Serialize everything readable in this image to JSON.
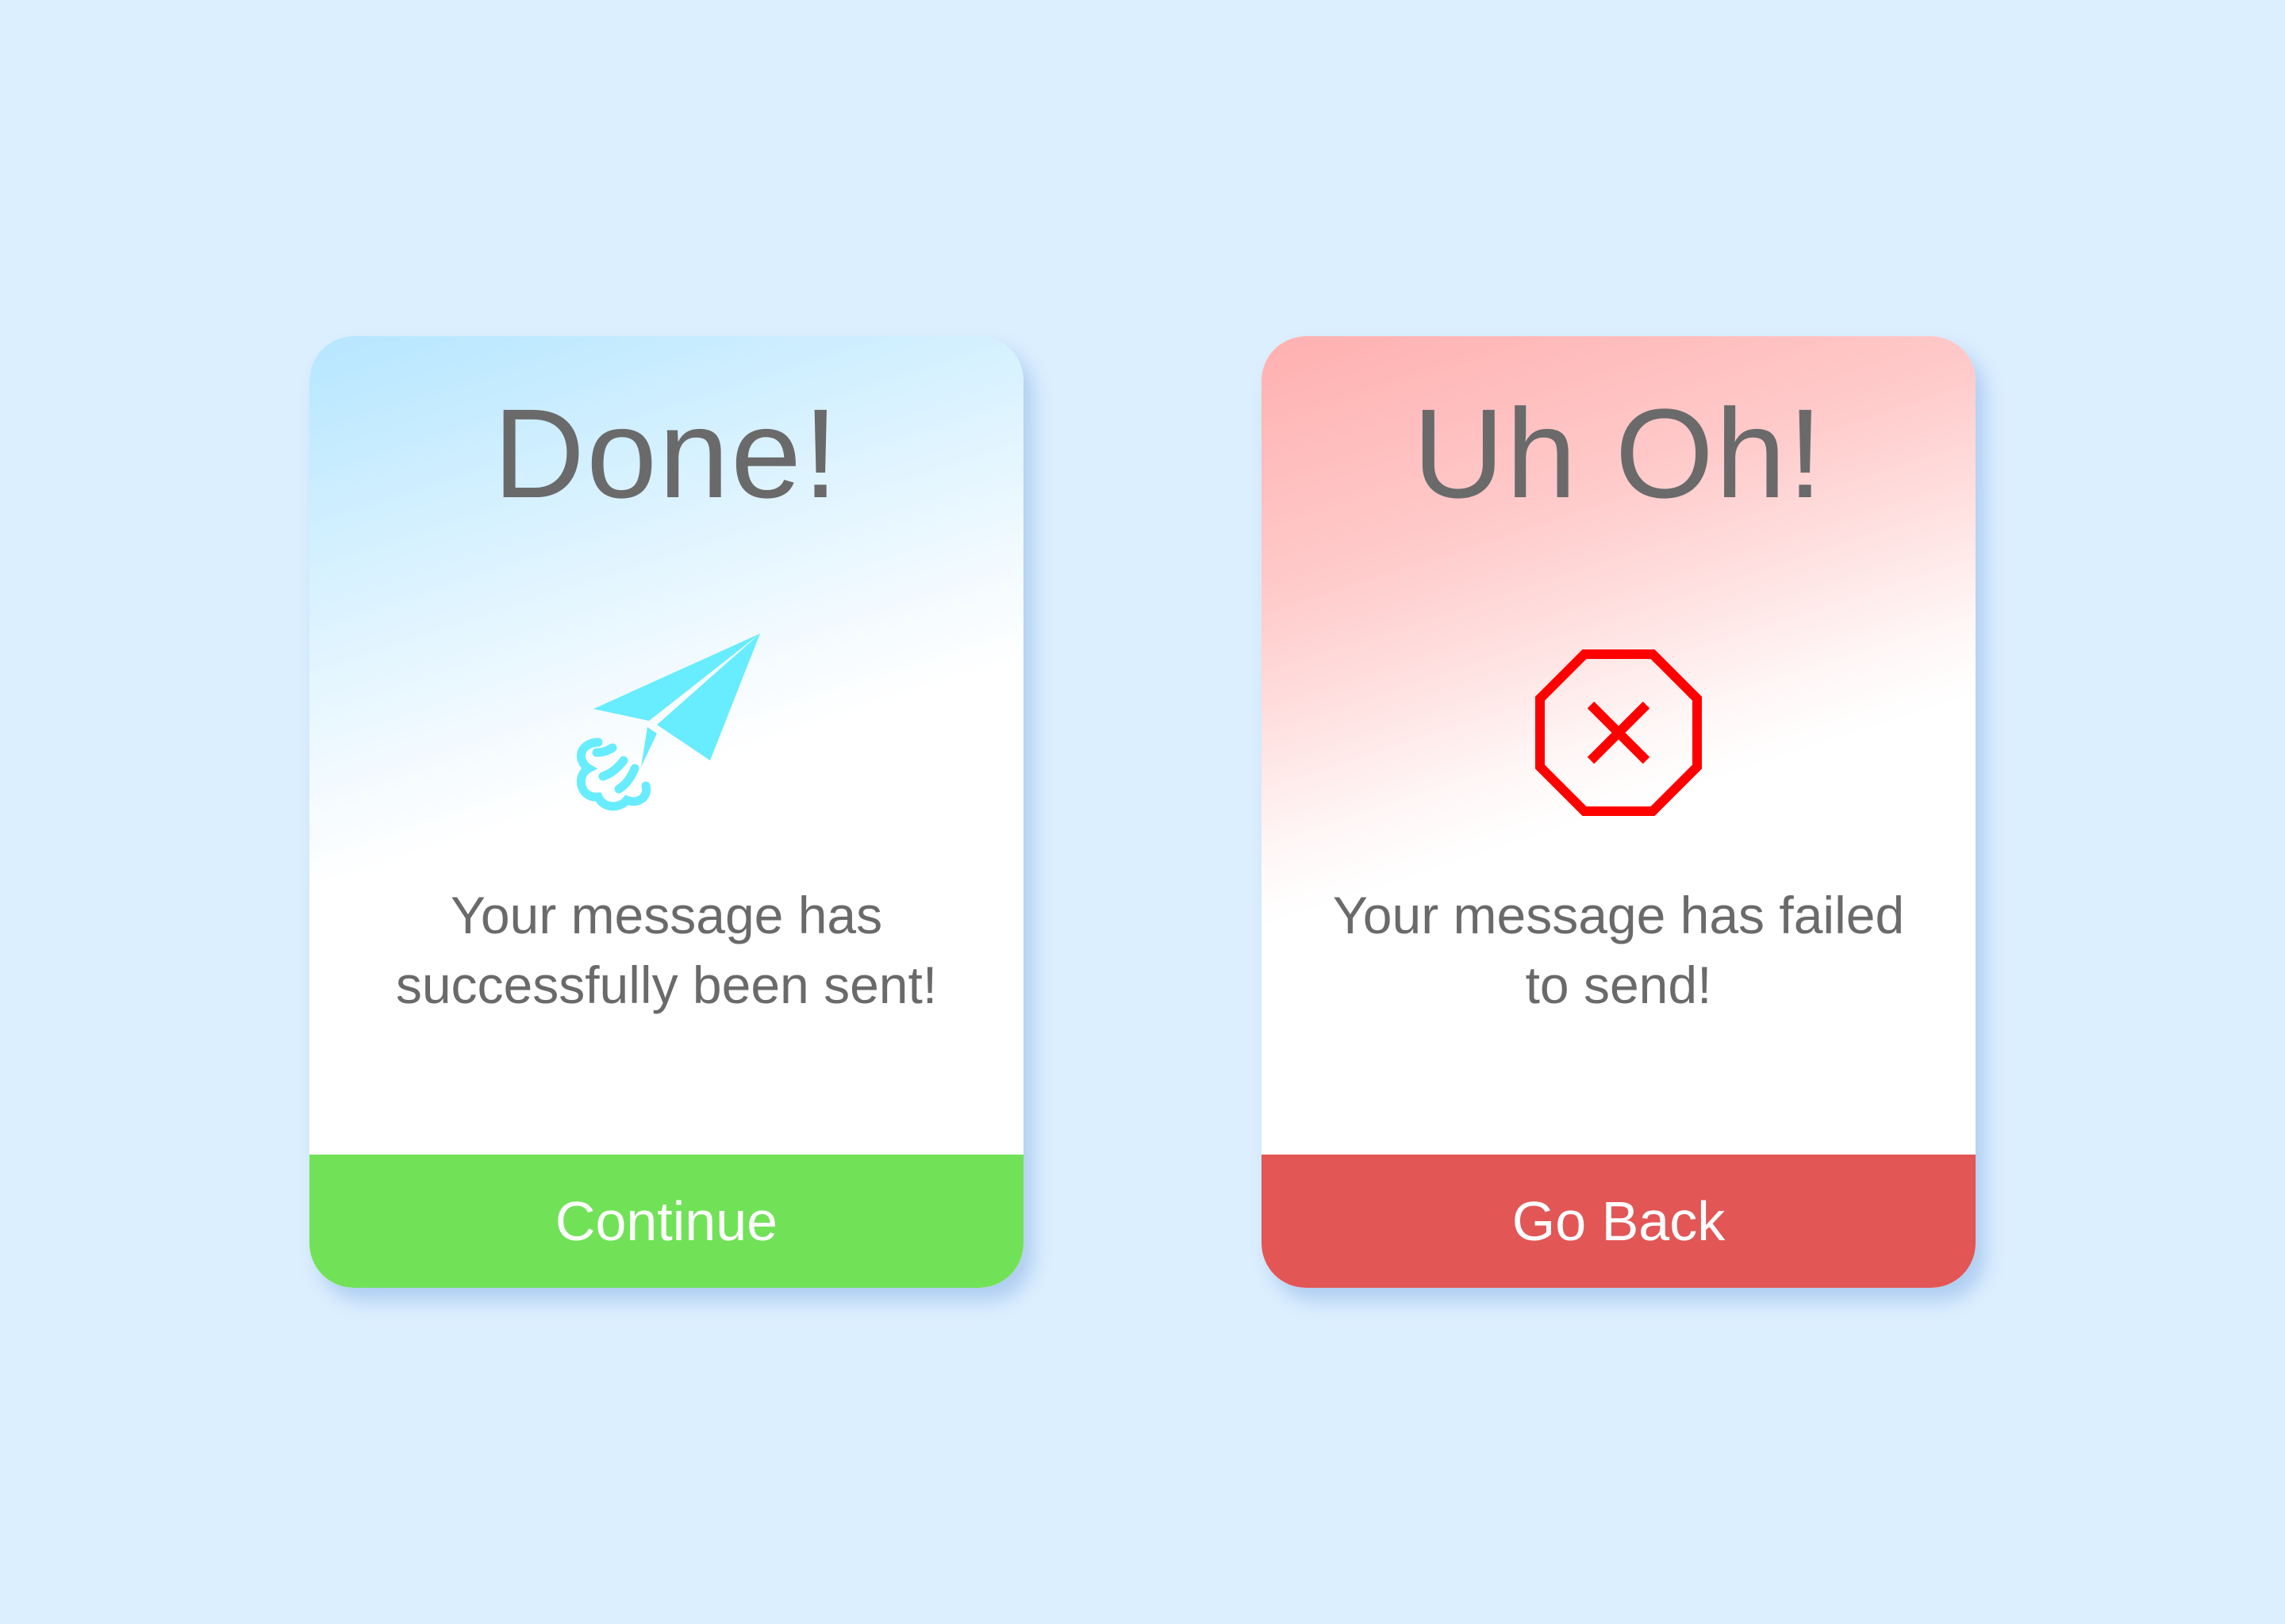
{
  "colors": {
    "background": "#dcefff",
    "success_accent": "#71e257",
    "error_accent": "#e25656",
    "plane_icon": "#68ecff",
    "stop_icon": "#ff0000",
    "text": "#6a6a6a",
    "button_text": "#ffffff"
  },
  "success_card": {
    "title": "Done!",
    "icon": "paper-plane-icon",
    "message_line1": "Your message has",
    "message_line2": "successfully been sent!",
    "button_label": "Continue"
  },
  "error_card": {
    "title": "Uh Oh!",
    "icon": "stop-octagon-x-icon",
    "message_line1": "Your message has failed",
    "message_line2": "to send!",
    "button_label": "Go Back"
  }
}
